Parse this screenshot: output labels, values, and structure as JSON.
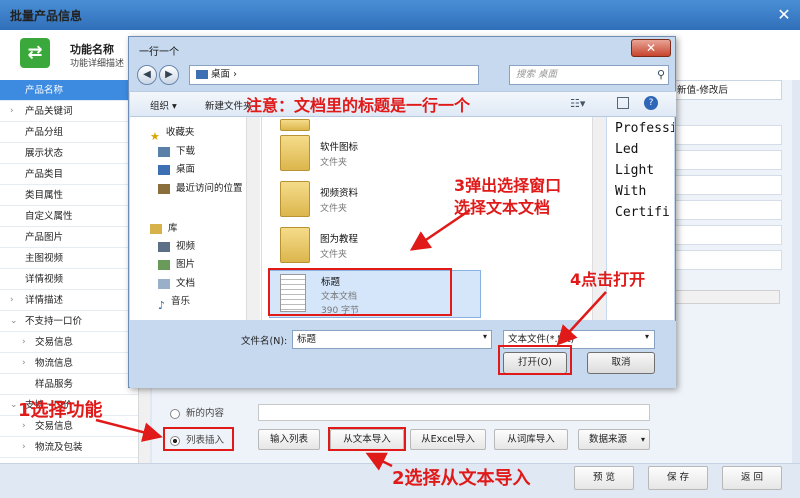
{
  "window": {
    "title": "批量产品信息",
    "close": "✕"
  },
  "header": {
    "func_title": "功能名称",
    "func_desc": "功能详细描述"
  },
  "sidebar": {
    "items": [
      {
        "label": "产品名称",
        "active": true,
        "arrow": ""
      },
      {
        "label": "产品关键词",
        "arrow": "›"
      },
      {
        "label": "产品分组",
        "arrow": ""
      },
      {
        "label": "展示状态",
        "arrow": ""
      },
      {
        "label": "产品类目",
        "arrow": ""
      },
      {
        "label": "类目属性",
        "arrow": ""
      },
      {
        "label": "自定义属性",
        "arrow": ""
      },
      {
        "label": "产品图片",
        "arrow": ""
      },
      {
        "label": "主图视频",
        "arrow": ""
      },
      {
        "label": "详情视频",
        "arrow": ""
      },
      {
        "label": "详情描述",
        "arrow": "›"
      },
      {
        "label": "不支持一口价",
        "arrow": "⌄"
      },
      {
        "label": "交易信息",
        "arrow": "›",
        "sub": true
      },
      {
        "label": "物流信息",
        "arrow": "›",
        "sub": true
      },
      {
        "label": "样品服务",
        "arrow": "",
        "sub": true
      },
      {
        "label": "支持一口价",
        "arrow": "⌄"
      },
      {
        "label": "交易信息",
        "arrow": "›",
        "sub": true
      },
      {
        "label": "物流及包装",
        "arrow": "›",
        "sub": true
      }
    ]
  },
  "right_col": {
    "header": "新值-修改后"
  },
  "options": {
    "new_content": "新的内容",
    "list_insert": "列表插入"
  },
  "action_buttons": {
    "input_list": "输入列表",
    "from_text": "从文本导入",
    "from_excel": "从Excel导入",
    "from_dict": "从词库导入",
    "data_source": "数据来源"
  },
  "footer": {
    "preview": "预 览",
    "save": "保 存",
    "back": "返 回"
  },
  "dialog": {
    "title": "一行一个",
    "address": "桌面",
    "search_placeholder": "搜索 桌面",
    "organize": "组织 ▾",
    "new_folder": "新建文件夹",
    "nav": [
      {
        "label": "收藏夹",
        "icon": "star-icon"
      },
      {
        "label": "下载",
        "icon": "download-folder-icon"
      },
      {
        "label": "桌面",
        "icon": "desktop-icon"
      },
      {
        "label": "最近访问的位置",
        "icon": "recent-places-icon"
      },
      {
        "label": "库",
        "icon": "library-icon"
      },
      {
        "label": "视频",
        "icon": "video-library-icon"
      },
      {
        "label": "图片",
        "icon": "picture-library-icon"
      },
      {
        "label": "文档",
        "icon": "document-library-icon"
      },
      {
        "label": "音乐",
        "icon": "music-library-icon"
      }
    ],
    "files": [
      {
        "name": "软件图标",
        "type": "文件夹"
      },
      {
        "name": "视频资料",
        "type": "文件夹"
      },
      {
        "name": "图为教程",
        "type": "文件夹"
      }
    ],
    "selected_file": {
      "name": "标题",
      "type": "文本文档",
      "size": "390 字节"
    },
    "preview_text": "Professional Led Light With Certifi",
    "filename_label": "文件名(N):",
    "filename_value": "标题",
    "filetype_value": "文本文件(*.txt)",
    "open": "打开(O)",
    "cancel": "取消"
  },
  "annotations": {
    "note": "注意：文档里的标题是一行一个",
    "step1": "1选择功能",
    "step2": "2选择从文本导入",
    "step3_line1": "3弹出选择窗口",
    "step3_line2": "选择文本文档",
    "step4": "4点击打开"
  },
  "colors": {
    "accent": "#3c8be0",
    "annotation": "#e01919",
    "title_bar": "#2f6fb9"
  }
}
